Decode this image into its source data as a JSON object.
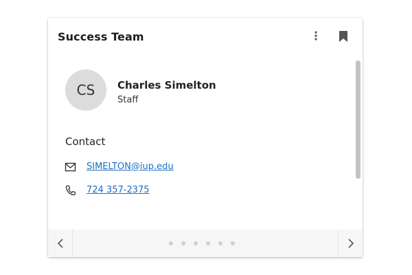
{
  "card": {
    "title": "Success Team",
    "menu_icon": "more-vertical-icon",
    "bookmark_icon": "bookmark-icon"
  },
  "person": {
    "initials": "CS",
    "name": "Charles Simelton",
    "role": "Staff"
  },
  "contact": {
    "heading": "Contact",
    "email": "SIMELTON@iup.edu",
    "email_icon": "envelope-icon",
    "phone": "724 357-2375",
    "phone_icon": "phone-icon"
  },
  "pager": {
    "prev_icon": "chevron-left-icon",
    "next_icon": "chevron-right-icon",
    "page_count": 6
  },
  "colors": {
    "link": "#1a6fc2",
    "avatar_bg": "#dcdcdc",
    "footer_bg": "#f6f6f6"
  }
}
